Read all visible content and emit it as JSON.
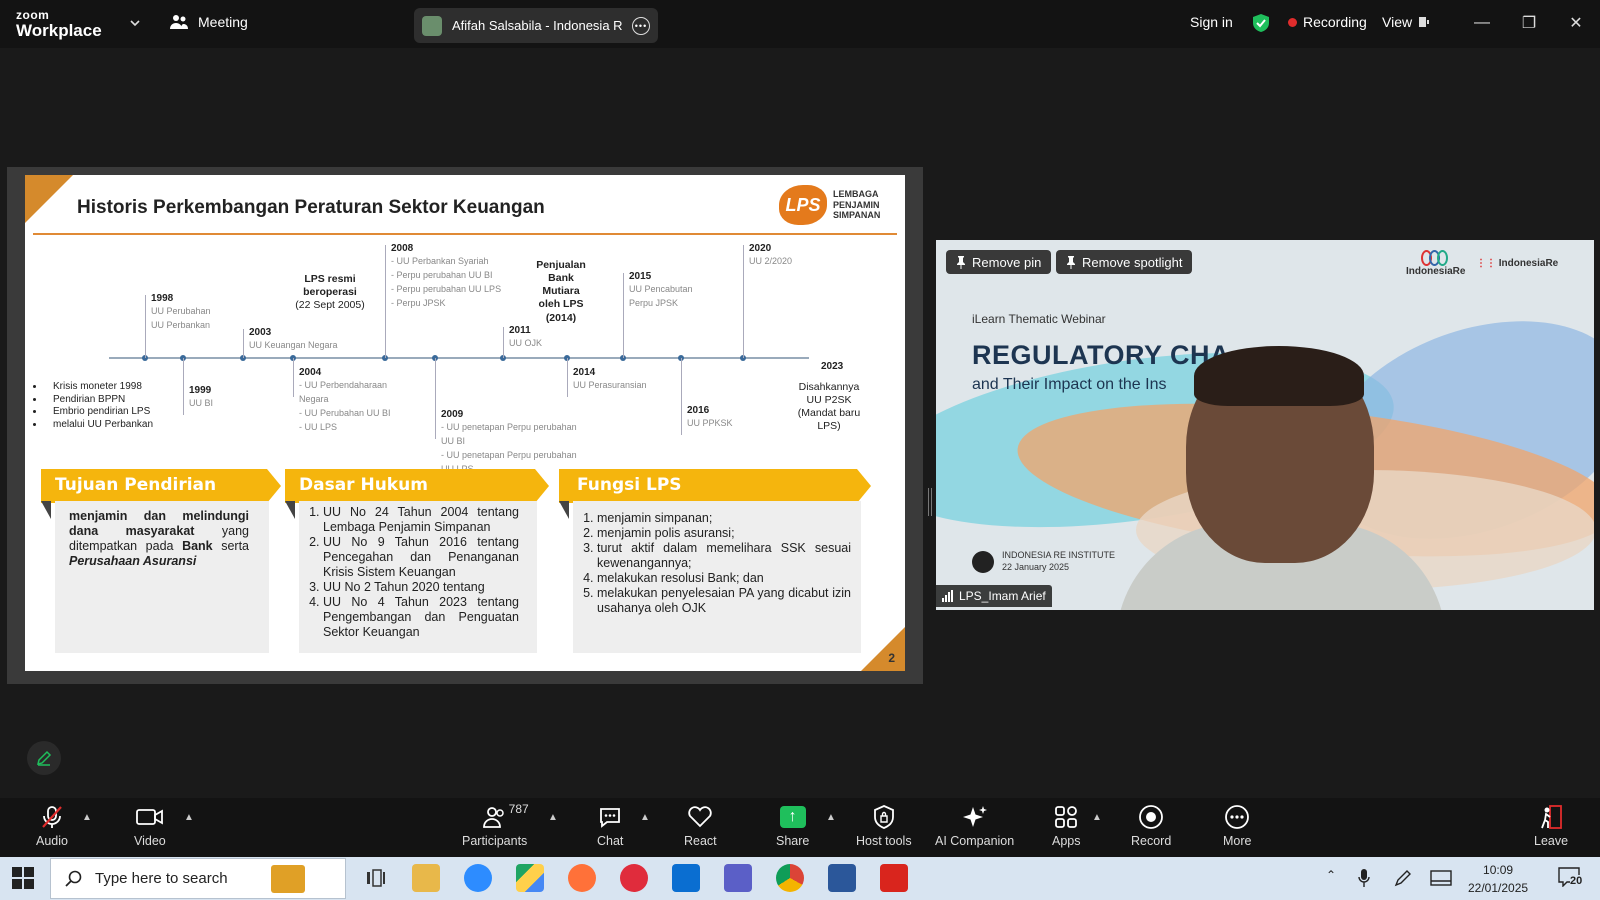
{
  "app": {
    "logo_top": "zoom",
    "logo_bottom": "Workplace",
    "meeting_label": "Meeting",
    "tab_title": "Afifah Salsabila - Indonesia Re's s"
  },
  "titlebar": {
    "sign_in": "Sign in",
    "recording": "Recording",
    "view": "View",
    "colors": {
      "recording_dot": "#e02c2c",
      "shield": "#1fbf5c"
    }
  },
  "slide": {
    "title": "Historis Perkembangan Peraturan Sektor Keuangan",
    "logo_mark": "LPS",
    "logo_lines": [
      "LEMBAGA",
      "PENJAMIN",
      "SIMPANAN"
    ],
    "page_number": "2",
    "timeline": [
      {
        "year": "1998",
        "lines": [
          "UU Perubahan",
          "UU Perbankan"
        ]
      },
      {
        "year": "1999",
        "lines": [
          "UU BI"
        ]
      },
      {
        "year": "2003",
        "lines": [
          "UU Keuangan Negara"
        ]
      },
      {
        "year": "2004",
        "lines": [
          "- UU Perbendaharaan",
          "  Negara",
          "- UU Perubahan UU BI",
          "- UU LPS"
        ]
      },
      {
        "year": "2008",
        "lines": [
          "- UU Perbankan Syariah",
          "- Perpu perubahan UU BI",
          "- Perpu perubahan UU LPS",
          "- Perpu JPSK"
        ]
      },
      {
        "year": "2009",
        "lines": [
          "- UU penetapan Perpu perubahan",
          "  UU BI",
          "- UU penetapan Perpu perubahan",
          "  UU LPS"
        ]
      },
      {
        "year": "2011",
        "lines": [
          "UU OJK"
        ]
      },
      {
        "year": "2014",
        "lines": [
          "UU Perasuransian"
        ]
      },
      {
        "year": "2015",
        "lines": [
          "UU Pencabutan",
          "Perpu JPSK"
        ]
      },
      {
        "year": "2016",
        "lines": [
          "UU PPKSK"
        ]
      },
      {
        "year": "2020",
        "lines": [
          "UU 2/2020"
        ]
      },
      {
        "year": "2023",
        "lines": []
      }
    ],
    "lps_established": [
      "LPS resmi",
      "beroperasi",
      "(22 Sept 2005)"
    ],
    "bank_mutiara": [
      "Penjualan",
      "Bank",
      "Mutiara",
      "oleh LPS",
      "(2014)"
    ],
    "p2sk": [
      "Disahkannya",
      "UU P2SK",
      "(Mandat baru",
      "LPS)"
    ],
    "bullets": [
      "Krisis moneter 1998",
      "Pendirian BPPN",
      "Embrio pendirian LPS",
      "melalui UU Perbankan"
    ],
    "sections": [
      {
        "title": "Tujuan Pendirian",
        "parts": [
          "menjamin dan melindungi dana masyarakat",
          " yang ditempatkan pada ",
          "Bank",
          " serta ",
          "Perusahaan Asuransi"
        ]
      },
      {
        "title": "Dasar Hukum",
        "items": [
          "UU No 24 Tahun 2004 tentang Lembaga Penjamin Simpanan",
          "UU No 9 Tahun 2016 tentang Pencegahan dan Penanganan Krisis Sistem Keuangan",
          "UU No 2 Tahun 2020 tentang",
          "UU No 4 Tahun 2023 tentang Pengembangan dan Penguatan Sektor Keuangan"
        ]
      },
      {
        "title": "Fungsi LPS",
        "items": [
          "menjamin simpanan;",
          "menjamin polis asuransi;",
          "turut aktif dalam memelihara SSK sesuai kewenangannya;",
          "melakukan resolusi Bank; dan",
          "melakukan penyelesaian PA yang dicabut izin usahanya oleh OJK"
        ]
      }
    ],
    "colors": {
      "accent": "#d58a2c",
      "band": "#f5b50d",
      "logo": "#e47a1c"
    }
  },
  "video": {
    "remove_pin": "Remove pin",
    "remove_spotlight": "Remove spotlight",
    "webinar_label": "iLearn Thematic Webinar",
    "headline": "REGULATORY CHA",
    "headline2": "and Their Impact on the Ins",
    "logo1": "IndonesiaRe",
    "logo2": "IndonesiaRe",
    "institute": "INDONESIA RE INSTITUTE",
    "date": "22 January 2025",
    "participant_name": "LPS_Imam Arief"
  },
  "toolbar": {
    "audio": "Audio",
    "video": "Video",
    "participants": "Participants",
    "participants_count": "787",
    "chat": "Chat",
    "react": "React",
    "share": "Share",
    "host_tools": "Host tools",
    "ai_companion": "AI Companion",
    "apps": "Apps",
    "record": "Record",
    "more": "More",
    "leave": "Leave"
  },
  "taskbar": {
    "search_placeholder": "Type here to search",
    "time": "10:09",
    "date": "22/01/2025",
    "notifications": "20"
  }
}
